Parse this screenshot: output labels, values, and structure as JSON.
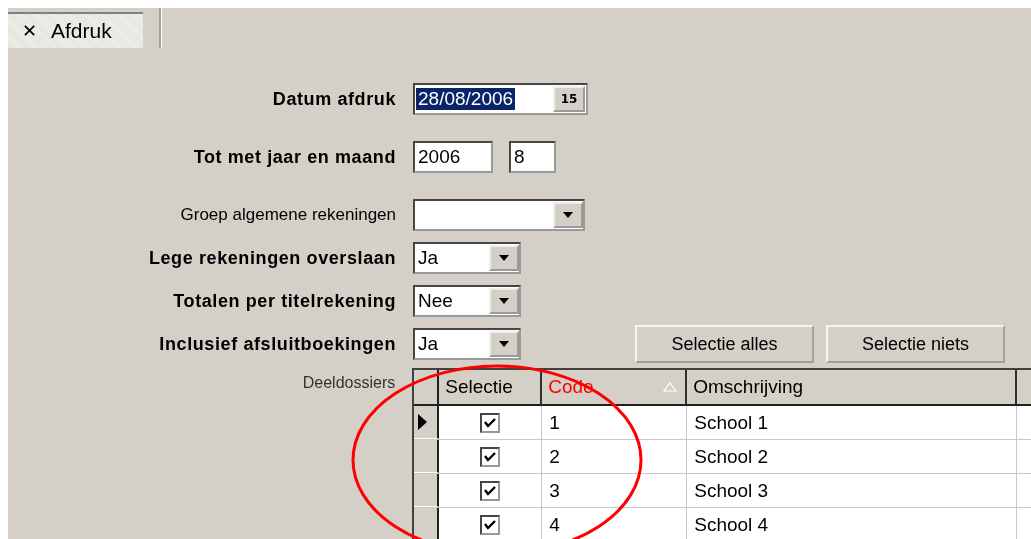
{
  "tab": {
    "label": "Afdruk",
    "close": "✕"
  },
  "fields": [
    {
      "kind": "date",
      "label": "Datum afdruk",
      "bold": true,
      "value": "28/08/2006",
      "selected": true,
      "button": "15"
    },
    {
      "kind": "pair",
      "label": "Tot met jaar en maand",
      "bold": true,
      "values": [
        "2006",
        "8"
      ]
    },
    {
      "kind": "combo",
      "label": "Groep algemene rekeningen",
      "bold": false,
      "wide": true
    },
    {
      "kind": "combo",
      "label": "Lege rekeningen overslaan",
      "bold": true,
      "value": "Ja"
    },
    {
      "kind": "combo",
      "label": "Totalen per titelrekening",
      "bold": true,
      "value": "Nee"
    },
    {
      "kind": "combo",
      "label": "Inclusief afsluitboekingen",
      "bold": true,
      "value": "Ja"
    }
  ],
  "buttons": [
    "Selectie alles",
    "Selectie niets"
  ],
  "grid": {
    "label": "Deeldossiers",
    "columns": [
      {
        "label": "Selectie",
        "sorted": false
      },
      {
        "label": "Code",
        "sorted": true
      },
      {
        "label": "Omschrijving",
        "sorted": false
      }
    ],
    "rows": [
      {
        "current": true,
        "checked": true,
        "code": "1",
        "description": "School 1"
      },
      {
        "current": false,
        "checked": true,
        "code": "2",
        "description": "School 2"
      },
      {
        "current": false,
        "checked": true,
        "code": "3",
        "description": "School 3"
      },
      {
        "current": false,
        "checked": true,
        "code": "4",
        "description": "School 4"
      }
    ]
  },
  "annotation": {
    "kind": "ellipse",
    "color": "#ff0000"
  }
}
